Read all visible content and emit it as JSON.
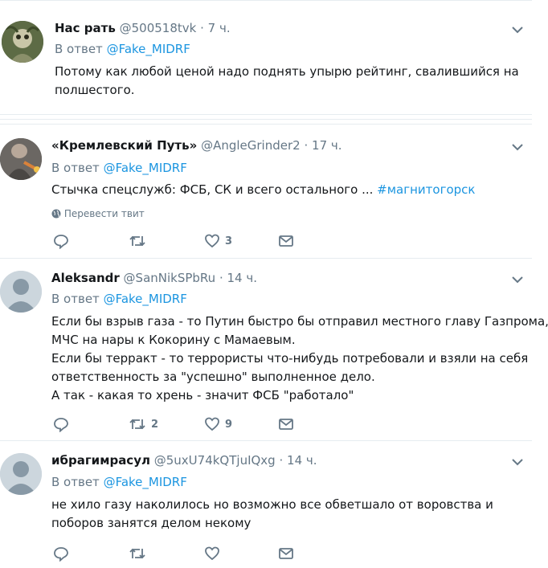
{
  "tweets": [
    {
      "name": "Нас рать",
      "handle": "@500518tvk",
      "time": "· 7 ч.",
      "reply_prefix": "В ответ",
      "reply_to": "@Fake_MIDRF",
      "lines": [
        "Потому как любой ценой надо поднять упырю рейтинг, свалившийся на",
        "полшестого."
      ]
    },
    {
      "name": "«Кремлевский Путь»",
      "handle": "@AngleGrinder2",
      "time": "· 17 ч.",
      "reply_prefix": "В ответ",
      "reply_to": "@Fake_MIDRF",
      "text_main": "Стычка спецслужб: ФСБ, СК и всего остального ... ",
      "text_tag": "#магнитогорск",
      "translate": "Перевести твит",
      "reply_count": "",
      "retweet_count": "",
      "like_count": "3"
    },
    {
      "name": "Aleksandr",
      "handle": "@SanNikSPbRu",
      "time": "· 14 ч.",
      "reply_prefix": "В ответ",
      "reply_to": "@Fake_MIDRF",
      "lines": [
        "Если бы взрыв газа - то Путин быстро бы отправил местного главу Газпрома,",
        "МЧС на нары  к Кокорину с Мамаевым.",
        "Если бы терракт - то террористы что-нибудь потребовали и взяли на себя",
        "ответственность за \"успешно\" выполненное дело.",
        "А так - какая то хрень - значит ФСБ \"работало\""
      ],
      "reply_count": "",
      "retweet_count": "2",
      "like_count": "9"
    },
    {
      "name": "ибрагимрасул",
      "handle": "@5uxU74kQTjuIQxg",
      "time": "· 14 ч.",
      "reply_prefix": "В ответ",
      "reply_to": "@Fake_MIDRF",
      "lines": [
        "не хило газу наколилось но возможно все обветшало от воровства и",
        "поборов занятся делом некому"
      ],
      "reply_count": "",
      "retweet_count": "",
      "like_count": ""
    }
  ],
  "colors": {
    "text": "#14171a",
    "secondary": "#657786",
    "link": "#1b95e0",
    "border": "#e6ecf0"
  }
}
